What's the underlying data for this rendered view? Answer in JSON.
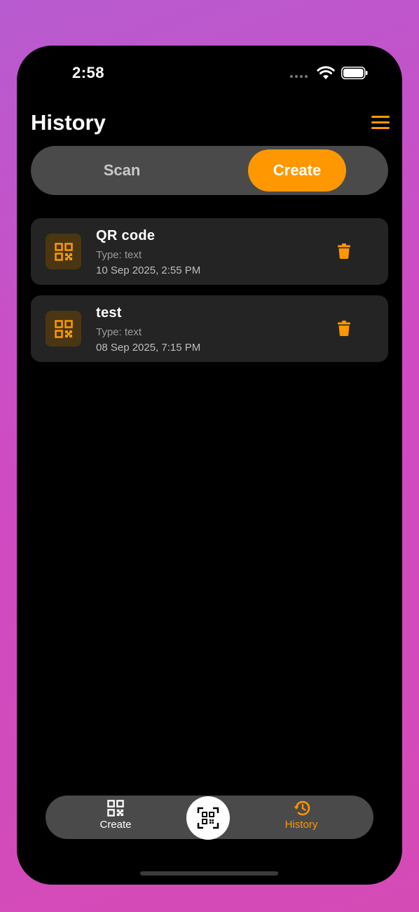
{
  "status_bar": {
    "time": "2:58"
  },
  "header": {
    "title": "History"
  },
  "segments": {
    "scan_label": "Scan",
    "create_label": "Create",
    "selected": "Create"
  },
  "history": [
    {
      "title": "QR code",
      "type": "Type: text",
      "date": "10 Sep 2025, 2:55 PM",
      "icon": "qr-code-icon"
    },
    {
      "title": "test",
      "type": "Type: text",
      "date": "08 Sep 2025, 7:15 PM",
      "icon": "qr-code-icon"
    }
  ],
  "tabbar": {
    "create_label": "Create",
    "history_label": "History",
    "active": "History"
  },
  "colors": {
    "accent": "#ff9800",
    "background": "#000000",
    "card": "#242424",
    "pill": "#4a4a4a"
  }
}
